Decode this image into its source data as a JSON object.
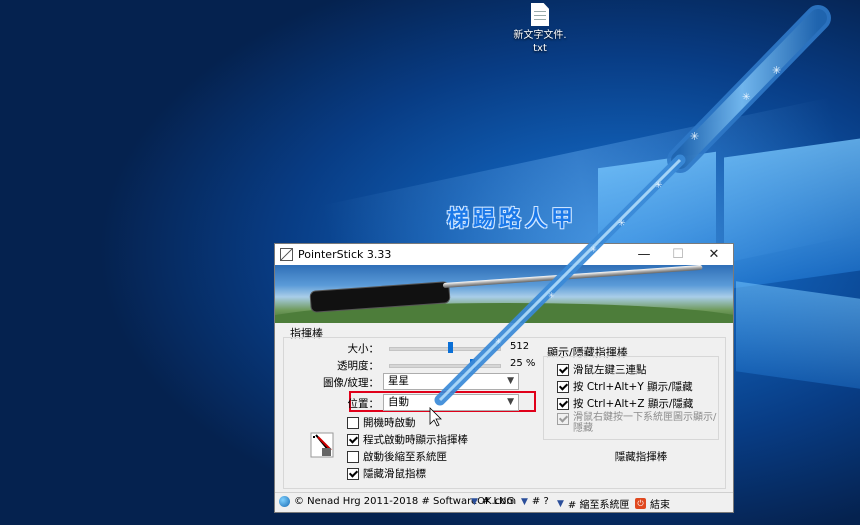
{
  "desktop": {
    "file_label_line1": "新文字文件.",
    "file_label_line2": "txt",
    "watermark": "梯踢路人甲"
  },
  "window": {
    "title": "PointerStick 3.33",
    "controls": {
      "minimize": "—",
      "maximize": "☐",
      "close": "✕"
    },
    "main_group": {
      "title": "指揮棒",
      "size": {
        "label": "大小：",
        "value": "512",
        "level_percent": 55
      },
      "opacity": {
        "label": "透明度：",
        "value": "25",
        "unit": "%",
        "level_percent": 75
      },
      "texture": {
        "label": "圖像/紋理：",
        "selected": "星星"
      },
      "position": {
        "label": "位置：",
        "selected": "自動",
        "highlight_color": "#e0001a"
      },
      "options": [
        {
          "label": "開機時啟動",
          "checked": false
        },
        {
          "label": "程式啟動時顯示指揮棒",
          "checked": true
        },
        {
          "label": "啟動後縮至系統匣",
          "checked": false
        },
        {
          "label": "隱藏滑鼠指標",
          "checked": true
        }
      ]
    },
    "hide_group": {
      "title": "顯示/隱藏指揮棒",
      "options": [
        {
          "label": "滑鼠左鍵三連點",
          "checked": true,
          "disabled": false
        },
        {
          "label": "按 Ctrl+Alt+Y 顯示/隱藏",
          "checked": true,
          "disabled": false
        },
        {
          "label": "按 Ctrl+Alt+Z 顯示/隱藏",
          "checked": true,
          "disabled": false
        },
        {
          "label_line1": "滑鼠右鍵按一下系統匣圖示顯示/",
          "label_line2": "隱藏",
          "checked": true,
          "disabled": true
        }
      ],
      "hide_button": "隱藏指揮棒"
    },
    "footer": {
      "copyright": "© Nenad Hrg 2011-2018 # SoftwareOK.com",
      "lng": "# LNG",
      "help": "# ?",
      "tray": "# 縮至系統匣",
      "exit": "結束"
    }
  }
}
